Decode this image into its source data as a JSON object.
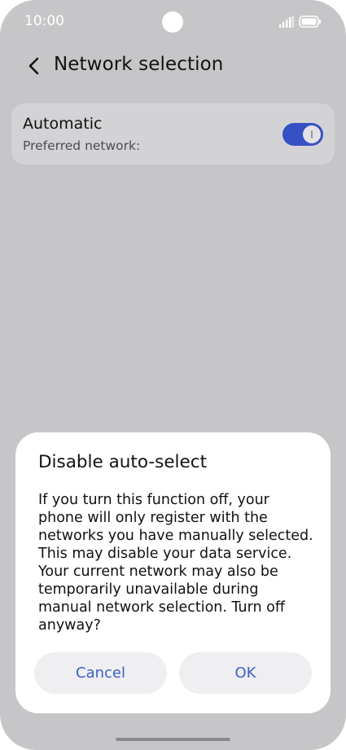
{
  "status_bar": {
    "time": "10:00",
    "icons": [
      "signal-icon",
      "battery-icon"
    ]
  },
  "header": {
    "back_icon": "chevron-left-icon",
    "title": "Network selection"
  },
  "setting": {
    "title": "Automatic",
    "subtitle": "Preferred network:",
    "toggle_on": true,
    "accent_color": "#3551c4"
  },
  "dialog": {
    "title": "Disable auto-select",
    "body": "If you turn this function off, your phone will only register with the networks you have manually selected. This may disable your data service. Your current network may also be temporarily unavailable during manual network selection. Turn off anyway?",
    "cancel_label": "Cancel",
    "ok_label": "OK",
    "button_text_color": "#3a5fc8"
  }
}
